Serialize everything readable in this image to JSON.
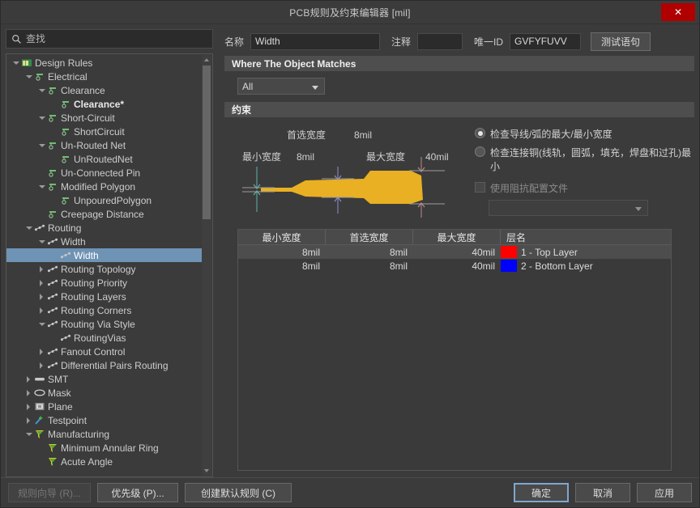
{
  "window": {
    "title": "PCB规则及约束编辑器 [mil]",
    "close_label": "✕"
  },
  "search": {
    "placeholder": "查找",
    "value": "",
    "icon": "search-icon"
  },
  "tree": {
    "items": [
      {
        "label": "Design Rules",
        "depth": 0,
        "arrow": "down",
        "icon": "folder-icon",
        "selected": false,
        "bold": false
      },
      {
        "label": "Electrical",
        "depth": 1,
        "arrow": "down",
        "icon": "electrical-icon",
        "selected": false,
        "bold": false
      },
      {
        "label": "Clearance",
        "depth": 2,
        "arrow": "down",
        "icon": "electrical-icon",
        "selected": false,
        "bold": false
      },
      {
        "label": "Clearance*",
        "depth": 3,
        "arrow": "none",
        "icon": "electrical-icon",
        "selected": false,
        "bold": true
      },
      {
        "label": "Short-Circuit",
        "depth": 2,
        "arrow": "down",
        "icon": "electrical-icon",
        "selected": false,
        "bold": false
      },
      {
        "label": "ShortCircuit",
        "depth": 3,
        "arrow": "none",
        "icon": "electrical-icon",
        "selected": false,
        "bold": false
      },
      {
        "label": "Un-Routed Net",
        "depth": 2,
        "arrow": "down",
        "icon": "electrical-icon",
        "selected": false,
        "bold": false
      },
      {
        "label": "UnRoutedNet",
        "depth": 3,
        "arrow": "none",
        "icon": "electrical-icon",
        "selected": false,
        "bold": false
      },
      {
        "label": "Un-Connected Pin",
        "depth": 2,
        "arrow": "none",
        "icon": "electrical-icon",
        "selected": false,
        "bold": false
      },
      {
        "label": "Modified Polygon",
        "depth": 2,
        "arrow": "down",
        "icon": "electrical-icon",
        "selected": false,
        "bold": false
      },
      {
        "label": "UnpouredPolygon",
        "depth": 3,
        "arrow": "none",
        "icon": "electrical-icon",
        "selected": false,
        "bold": false
      },
      {
        "label": "Creepage Distance",
        "depth": 2,
        "arrow": "none",
        "icon": "electrical-icon",
        "selected": false,
        "bold": false
      },
      {
        "label": "Routing",
        "depth": 1,
        "arrow": "down",
        "icon": "routing-icon",
        "selected": false,
        "bold": false
      },
      {
        "label": "Width",
        "depth": 2,
        "arrow": "down",
        "icon": "routing-icon",
        "selected": false,
        "bold": false
      },
      {
        "label": "Width",
        "depth": 3,
        "arrow": "none",
        "icon": "routing-icon",
        "selected": true,
        "bold": false
      },
      {
        "label": "Routing Topology",
        "depth": 2,
        "arrow": "right",
        "icon": "routing-icon",
        "selected": false,
        "bold": false
      },
      {
        "label": "Routing Priority",
        "depth": 2,
        "arrow": "right",
        "icon": "routing-icon",
        "selected": false,
        "bold": false
      },
      {
        "label": "Routing Layers",
        "depth": 2,
        "arrow": "right",
        "icon": "routing-icon",
        "selected": false,
        "bold": false
      },
      {
        "label": "Routing Corners",
        "depth": 2,
        "arrow": "right",
        "icon": "routing-icon",
        "selected": false,
        "bold": false
      },
      {
        "label": "Routing Via Style",
        "depth": 2,
        "arrow": "down",
        "icon": "routing-icon",
        "selected": false,
        "bold": false
      },
      {
        "label": "RoutingVias",
        "depth": 3,
        "arrow": "none",
        "icon": "routing-icon",
        "selected": false,
        "bold": false
      },
      {
        "label": "Fanout Control",
        "depth": 2,
        "arrow": "right",
        "icon": "routing-icon",
        "selected": false,
        "bold": false
      },
      {
        "label": "Differential Pairs Routing",
        "depth": 2,
        "arrow": "right",
        "icon": "routing-icon",
        "selected": false,
        "bold": false
      },
      {
        "label": "SMT",
        "depth": 1,
        "arrow": "right",
        "icon": "smt-icon",
        "selected": false,
        "bold": false
      },
      {
        "label": "Mask",
        "depth": 1,
        "arrow": "right",
        "icon": "mask-icon",
        "selected": false,
        "bold": false
      },
      {
        "label": "Plane",
        "depth": 1,
        "arrow": "right",
        "icon": "plane-icon",
        "selected": false,
        "bold": false
      },
      {
        "label": "Testpoint",
        "depth": 1,
        "arrow": "right",
        "icon": "testpoint-icon",
        "selected": false,
        "bold": false
      },
      {
        "label": "Manufacturing",
        "depth": 1,
        "arrow": "down",
        "icon": "manufact-icon",
        "selected": false,
        "bold": false
      },
      {
        "label": "Minimum Annular Ring",
        "depth": 2,
        "arrow": "none",
        "icon": "manufact-icon",
        "selected": false,
        "bold": false
      },
      {
        "label": "Acute Angle",
        "depth": 2,
        "arrow": "none",
        "icon": "manufact-icon",
        "selected": false,
        "bold": false
      }
    ]
  },
  "form": {
    "name_label": "名称",
    "name_value": "Width",
    "comment_label": "注释",
    "comment_value": "",
    "uid_label": "唯一ID",
    "uid_value": "GVFYFUVV",
    "test_button": "测试语句"
  },
  "where_section": {
    "header": "Where The Object Matches",
    "scope_value": "All"
  },
  "constraints": {
    "header": "约束",
    "diagram": {
      "pref_label": "首选宽度",
      "pref_value": "8mil",
      "min_label": "最小宽度",
      "min_value": "8mil",
      "max_label": "最大宽度",
      "max_value": "40mil",
      "track_color": "#e8b022"
    },
    "options": {
      "radio_track_arc": "检查导线/弧的最大/最小宽度",
      "radio_track_arc_selected": true,
      "radio_connected_copper": "检查连接铜(线轨，圆弧，填充，焊盘和过孔)最小",
      "radio_connected_copper_selected": false,
      "impedance_checkbox": "使用阻抗配置文件",
      "impedance_checked": false,
      "impedance_value": ""
    },
    "table": {
      "columns": [
        "最小宽度",
        "首选宽度",
        "最大宽度",
        "层名"
      ],
      "rows": [
        {
          "min": "8mil",
          "pref": "8mil",
          "max": "40mil",
          "color": "#ff0000",
          "layer": "1 - Top Layer",
          "selected": true
        },
        {
          "min": "8mil",
          "pref": "8mil",
          "max": "40mil",
          "color": "#0000ff",
          "layer": "2 - Bottom Layer",
          "selected": false
        }
      ]
    }
  },
  "footer": {
    "rule_wizard": "规则向导 (R)...",
    "priority": "优先级 (P)...",
    "create_default_rules": "创建默认规则 (C)",
    "ok": "确定",
    "cancel": "取消",
    "apply": "应用"
  }
}
